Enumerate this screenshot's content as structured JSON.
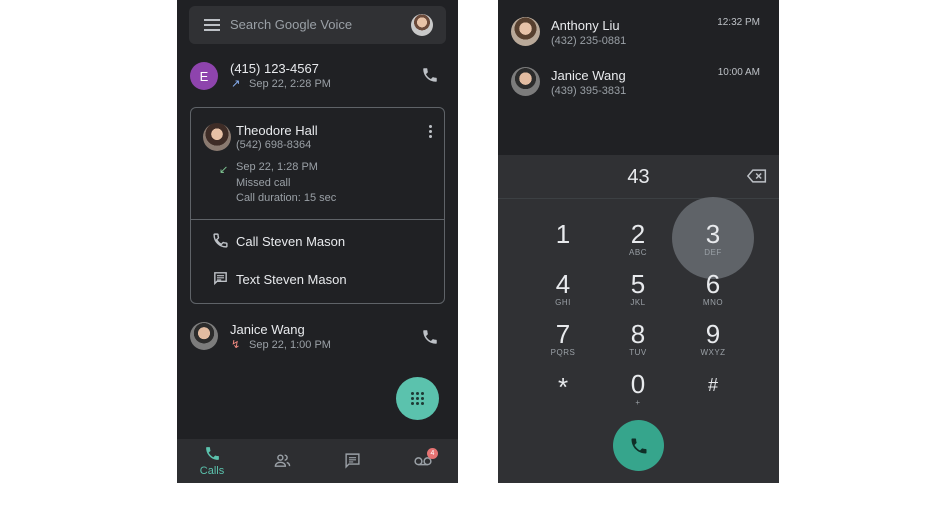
{
  "left": {
    "search": {
      "placeholder": "Search Google Voice"
    },
    "calls": [
      {
        "avatar_letter": "E",
        "number": "(415) 123-4567",
        "date": "Sep 22, 2:28 PM",
        "direction": "outgoing"
      },
      {
        "number": "(542) 698-8364"
      }
    ],
    "card": {
      "name": "Theodore Hall",
      "number": "(542) 698-8364",
      "time": "Sep 22, 1:28 PM",
      "status": "Missed call",
      "duration": "Call duration: 15 sec",
      "actions": [
        {
          "label": "Call Steven Mason",
          "icon": "phone-icon"
        },
        {
          "label": "Text Steven Mason",
          "icon": "message-icon"
        }
      ]
    },
    "last_call": {
      "name": "Janice Wang",
      "date": "Sep 22, 1:00 PM",
      "direction": "missed"
    },
    "nav": {
      "calls_label": "Calls",
      "voicemail_badge": "4",
      "active_color": "#5bc2ad"
    }
  },
  "right": {
    "recents": [
      {
        "name": "Anthony Liu",
        "number": "(432) 235-0881",
        "time": "12:32 PM"
      },
      {
        "name": "Janice Wang",
        "number": "(439) 395-3831",
        "time": "10:00 AM"
      }
    ],
    "dialed": "43",
    "keys": [
      {
        "digit": "1",
        "letters": ""
      },
      {
        "digit": "2",
        "letters": "ABC"
      },
      {
        "digit": "3",
        "letters": "DEF"
      },
      {
        "digit": "4",
        "letters": "GHI"
      },
      {
        "digit": "5",
        "letters": "JKL"
      },
      {
        "digit": "6",
        "letters": "MNO"
      },
      {
        "digit": "7",
        "letters": "PQRS"
      },
      {
        "digit": "8",
        "letters": "TUV"
      },
      {
        "digit": "9",
        "letters": "WXYZ"
      },
      {
        "digit": "*",
        "letters": ""
      },
      {
        "digit": "0",
        "letters": "+"
      },
      {
        "digit": "#",
        "letters": ""
      }
    ],
    "accent_color": "#36a58c"
  }
}
